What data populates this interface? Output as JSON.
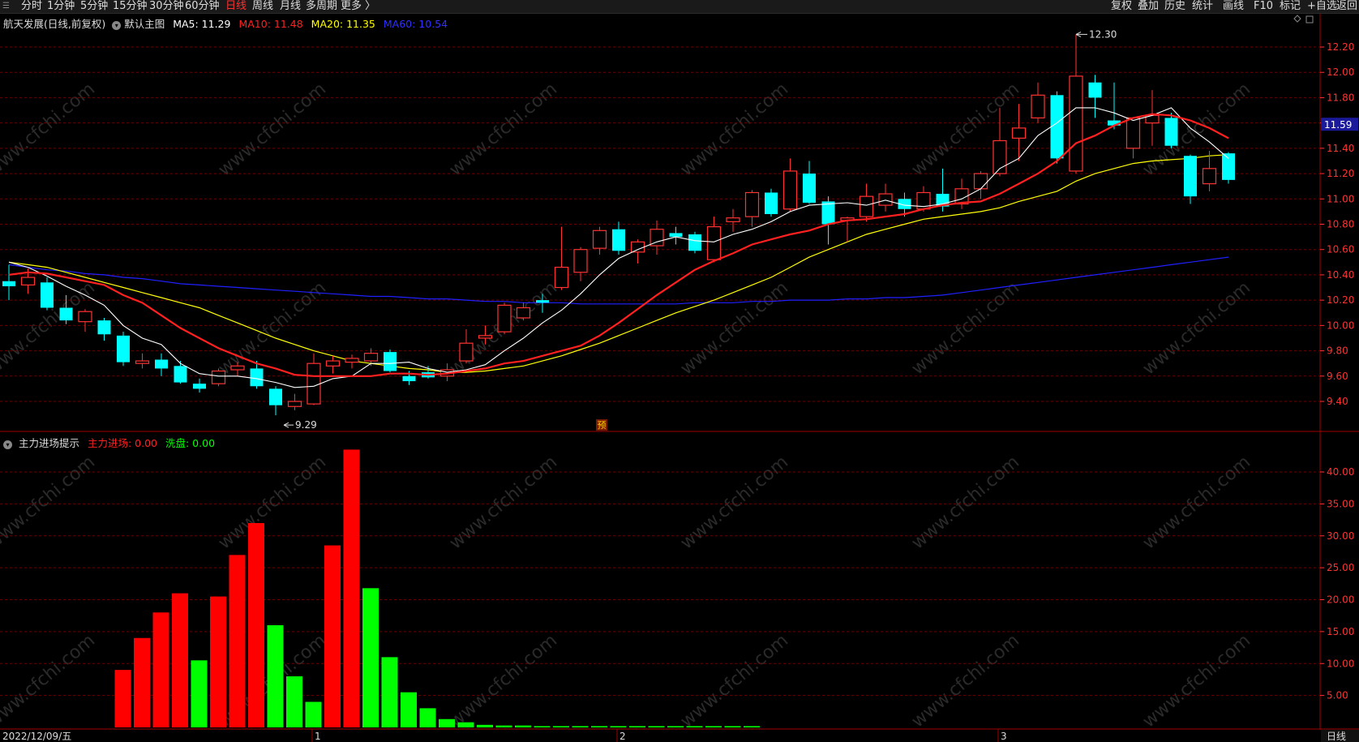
{
  "toolbar": {
    "left": [
      "分时",
      "1分钟",
      "5分钟",
      "15分钟",
      "30分钟",
      "60分钟",
      "日线",
      "周线",
      "月线",
      "多周期",
      "更多 〉"
    ],
    "active": "日线",
    "right": [
      "复权",
      "叠加",
      "历史",
      "统计",
      "画线",
      "F10",
      "标记",
      "+自选",
      "返回"
    ]
  },
  "main_header": {
    "stock": "航天发展(日线,前复权)",
    "template": "默认主图",
    "ma5": "MA5: 11.29",
    "ma10": "MA10: 11.48",
    "ma20": "MA20: 11.35",
    "ma60": "MA60: 10.54"
  },
  "sub_header": {
    "name": "主力进场提示",
    "s1": "主力进场: 0.00",
    "s2": "洗盘: 0.00"
  },
  "colors": {
    "up": "#ff3232",
    "down": "#00ffff",
    "ma5": "#ffffff",
    "ma10": "#ff2020",
    "ma20": "#ffff00",
    "ma60": "#2020ff",
    "grid": "#6a0000",
    "axis": "#ff3232",
    "bar_red": "#ff0000",
    "bar_green": "#00ff00"
  },
  "watermark": "www.cfchi.com",
  "price_marks": {
    "high": "12.30",
    "low": "9.29",
    "forecast": "预",
    "current": "11.59"
  },
  "bottom": {
    "date": "2022/12/09/五",
    "m1": "1",
    "m2": "2",
    "m3": "3",
    "period": "日线"
  },
  "chart_data": [
    {
      "type": "candlestick",
      "title": "航天发展(日线,前复权)",
      "ylim": [
        9.2,
        12.4
      ],
      "yticks": [
        9.4,
        9.6,
        9.8,
        10.0,
        10.2,
        10.4,
        10.6,
        10.8,
        11.0,
        11.2,
        11.4,
        11.6,
        11.8,
        12.0,
        12.2
      ],
      "current_price": 11.59,
      "candles": [
        {
          "o": 10.35,
          "h": 10.48,
          "l": 10.2,
          "c": 10.31
        },
        {
          "o": 10.32,
          "h": 10.45,
          "l": 10.25,
          "c": 10.38
        },
        {
          "o": 10.34,
          "h": 10.38,
          "l": 10.12,
          "c": 10.14
        },
        {
          "o": 10.14,
          "h": 10.24,
          "l": 10.01,
          "c": 10.04
        },
        {
          "o": 10.03,
          "h": 10.13,
          "l": 9.95,
          "c": 10.11
        },
        {
          "o": 10.04,
          "h": 10.06,
          "l": 9.88,
          "c": 9.93
        },
        {
          "o": 9.92,
          "h": 9.95,
          "l": 9.68,
          "c": 9.71
        },
        {
          "o": 9.7,
          "h": 9.78,
          "l": 9.66,
          "c": 9.72
        },
        {
          "o": 9.73,
          "h": 9.78,
          "l": 9.6,
          "c": 9.66
        },
        {
          "o": 9.68,
          "h": 9.72,
          "l": 9.54,
          "c": 9.55
        },
        {
          "o": 9.54,
          "h": 9.58,
          "l": 9.47,
          "c": 9.5
        },
        {
          "o": 9.54,
          "h": 9.66,
          "l": 9.52,
          "c": 9.64
        },
        {
          "o": 9.65,
          "h": 9.71,
          "l": 9.6,
          "c": 9.68
        },
        {
          "o": 9.66,
          "h": 9.72,
          "l": 9.5,
          "c": 9.52
        },
        {
          "o": 9.5,
          "h": 9.52,
          "l": 9.29,
          "c": 9.37
        },
        {
          "o": 9.36,
          "h": 9.46,
          "l": 9.33,
          "c": 9.4
        },
        {
          "o": 9.38,
          "h": 9.78,
          "l": 9.37,
          "c": 9.7
        },
        {
          "o": 9.68,
          "h": 9.76,
          "l": 9.62,
          "c": 9.72
        },
        {
          "o": 9.71,
          "h": 9.77,
          "l": 9.66,
          "c": 9.74
        },
        {
          "o": 9.72,
          "h": 9.82,
          "l": 9.68,
          "c": 9.78
        },
        {
          "o": 9.79,
          "h": 9.81,
          "l": 9.63,
          "c": 9.64
        },
        {
          "o": 9.6,
          "h": 9.64,
          "l": 9.53,
          "c": 9.56
        },
        {
          "o": 9.63,
          "h": 9.68,
          "l": 9.58,
          "c": 9.59
        },
        {
          "o": 9.6,
          "h": 9.7,
          "l": 9.56,
          "c": 9.65
        },
        {
          "o": 9.72,
          "h": 9.97,
          "l": 9.7,
          "c": 9.86
        },
        {
          "o": 9.9,
          "h": 10.0,
          "l": 9.85,
          "c": 9.92
        },
        {
          "o": 9.95,
          "h": 10.18,
          "l": 9.93,
          "c": 10.16
        },
        {
          "o": 10.06,
          "h": 10.18,
          "l": 10.04,
          "c": 10.14
        },
        {
          "o": 10.2,
          "h": 10.25,
          "l": 10.1,
          "c": 10.18
        },
        {
          "o": 10.3,
          "h": 10.78,
          "l": 10.28,
          "c": 10.46
        },
        {
          "o": 10.42,
          "h": 10.62,
          "l": 10.35,
          "c": 10.6
        },
        {
          "o": 10.61,
          "h": 10.78,
          "l": 10.56,
          "c": 10.75
        },
        {
          "o": 10.76,
          "h": 10.82,
          "l": 10.56,
          "c": 10.59
        },
        {
          "o": 10.58,
          "h": 10.68,
          "l": 10.49,
          "c": 10.66
        },
        {
          "o": 10.63,
          "h": 10.83,
          "l": 10.56,
          "c": 10.76
        },
        {
          "o": 10.73,
          "h": 10.78,
          "l": 10.64,
          "c": 10.7
        },
        {
          "o": 10.72,
          "h": 10.74,
          "l": 10.57,
          "c": 10.59
        },
        {
          "o": 10.52,
          "h": 10.86,
          "l": 10.5,
          "c": 10.78
        },
        {
          "o": 10.82,
          "h": 10.92,
          "l": 10.74,
          "c": 10.85
        },
        {
          "o": 10.86,
          "h": 11.07,
          "l": 10.78,
          "c": 11.05
        },
        {
          "o": 11.05,
          "h": 11.08,
          "l": 10.86,
          "c": 10.88
        },
        {
          "o": 10.92,
          "h": 11.32,
          "l": 10.9,
          "c": 11.22
        },
        {
          "o": 11.2,
          "h": 11.3,
          "l": 10.96,
          "c": 10.97
        },
        {
          "o": 10.98,
          "h": 11.02,
          "l": 10.64,
          "c": 10.8
        },
        {
          "o": 10.83,
          "h": 10.86,
          "l": 10.66,
          "c": 10.85
        },
        {
          "o": 10.86,
          "h": 11.12,
          "l": 10.82,
          "c": 11.02
        },
        {
          "o": 10.95,
          "h": 11.12,
          "l": 10.9,
          "c": 11.04
        },
        {
          "o": 11.0,
          "h": 11.05,
          "l": 10.86,
          "c": 10.92
        },
        {
          "o": 10.92,
          "h": 11.1,
          "l": 10.9,
          "c": 11.05
        },
        {
          "o": 11.04,
          "h": 11.24,
          "l": 10.9,
          "c": 10.94
        },
        {
          "o": 10.96,
          "h": 11.16,
          "l": 10.92,
          "c": 11.08
        },
        {
          "o": 11.08,
          "h": 11.22,
          "l": 11.0,
          "c": 11.2
        },
        {
          "o": 11.2,
          "h": 11.72,
          "l": 11.18,
          "c": 11.46
        },
        {
          "o": 11.48,
          "h": 11.75,
          "l": 11.3,
          "c": 11.56
        },
        {
          "o": 11.64,
          "h": 11.92,
          "l": 11.6,
          "c": 11.82
        },
        {
          "o": 11.82,
          "h": 11.85,
          "l": 11.28,
          "c": 11.32
        },
        {
          "o": 11.22,
          "h": 12.3,
          "l": 11.2,
          "c": 11.97
        },
        {
          "o": 11.92,
          "h": 11.98,
          "l": 11.64,
          "c": 11.8
        },
        {
          "o": 11.62,
          "h": 11.92,
          "l": 11.55,
          "c": 11.58
        },
        {
          "o": 11.4,
          "h": 11.62,
          "l": 11.32,
          "c": 11.64
        },
        {
          "o": 11.6,
          "h": 11.86,
          "l": 11.42,
          "c": 11.66
        },
        {
          "o": 11.64,
          "h": 11.68,
          "l": 11.4,
          "c": 11.42
        },
        {
          "o": 11.34,
          "h": 11.35,
          "l": 10.96,
          "c": 11.02
        },
        {
          "o": 11.12,
          "h": 11.38,
          "l": 11.06,
          "c": 11.24
        },
        {
          "o": 11.36,
          "h": 11.37,
          "l": 11.12,
          "c": 11.15
        }
      ],
      "ma5": [
        10.5,
        10.46,
        10.39,
        10.31,
        10.24,
        10.16,
        10.0,
        9.9,
        9.85,
        9.7,
        9.62,
        9.6,
        9.6,
        9.58,
        9.55,
        9.51,
        9.52,
        9.58,
        9.6,
        9.7,
        9.7,
        9.71,
        9.66,
        9.63,
        9.65,
        9.69,
        9.8,
        9.9,
        10.02,
        10.12,
        10.25,
        10.4,
        10.53,
        10.6,
        10.66,
        10.7,
        10.67,
        10.66,
        10.72,
        10.76,
        10.82,
        10.9,
        10.95,
        10.96,
        10.97,
        10.95,
        10.99,
        10.95,
        10.94,
        10.96,
        11.0,
        11.08,
        11.24,
        11.32,
        11.5,
        11.6,
        11.72,
        11.72,
        11.68,
        11.62,
        11.66,
        11.72,
        11.56,
        11.45,
        11.32
      ],
      "ma10": [
        10.4,
        10.42,
        10.41,
        10.38,
        10.35,
        10.32,
        10.24,
        10.18,
        10.08,
        9.98,
        9.9,
        9.82,
        9.76,
        9.7,
        9.66,
        9.61,
        9.6,
        9.6,
        9.6,
        9.6,
        9.62,
        9.62,
        9.61,
        9.62,
        9.64,
        9.66,
        9.7,
        9.72,
        9.76,
        9.8,
        9.84,
        9.92,
        10.02,
        10.13,
        10.24,
        10.34,
        10.44,
        10.51,
        10.57,
        10.64,
        10.68,
        10.72,
        10.75,
        10.8,
        10.83,
        10.84,
        10.86,
        10.88,
        10.92,
        10.95,
        10.97,
        10.98,
        11.04,
        11.12,
        11.2,
        11.3,
        11.44,
        11.5,
        11.58,
        11.64,
        11.67,
        11.66,
        11.62,
        11.56,
        11.48
      ],
      "ma20": [
        10.5,
        10.48,
        10.46,
        10.42,
        10.38,
        10.34,
        10.3,
        10.26,
        10.22,
        10.18,
        10.14,
        10.08,
        10.02,
        9.96,
        9.9,
        9.85,
        9.8,
        9.76,
        9.72,
        9.7,
        9.68,
        9.66,
        9.65,
        9.63,
        9.63,
        9.64,
        9.66,
        9.68,
        9.72,
        9.76,
        9.81,
        9.86,
        9.92,
        9.98,
        10.04,
        10.1,
        10.15,
        10.2,
        10.26,
        10.32,
        10.38,
        10.46,
        10.54,
        10.6,
        10.66,
        10.72,
        10.76,
        10.8,
        10.84,
        10.86,
        10.88,
        10.9,
        10.93,
        10.98,
        11.02,
        11.06,
        11.14,
        11.2,
        11.24,
        11.28,
        11.3,
        11.31,
        11.32,
        11.34,
        11.35
      ],
      "ma60": [
        10.48,
        10.46,
        10.44,
        10.43,
        10.41,
        10.4,
        10.38,
        10.37,
        10.35,
        10.33,
        10.32,
        10.31,
        10.3,
        10.29,
        10.28,
        10.27,
        10.26,
        10.25,
        10.24,
        10.23,
        10.23,
        10.22,
        10.21,
        10.21,
        10.2,
        10.19,
        10.19,
        10.18,
        10.18,
        10.18,
        10.17,
        10.17,
        10.17,
        10.17,
        10.17,
        10.17,
        10.18,
        10.18,
        10.18,
        10.19,
        10.19,
        10.2,
        10.2,
        10.2,
        10.21,
        10.21,
        10.22,
        10.22,
        10.23,
        10.24,
        10.26,
        10.28,
        10.3,
        10.32,
        10.34,
        10.36,
        10.38,
        10.4,
        10.42,
        10.44,
        10.46,
        10.48,
        10.5,
        10.52,
        10.54
      ]
    },
    {
      "type": "bar",
      "title": "主力进场提示",
      "ylim": [
        0,
        45
      ],
      "yticks": [
        5,
        10,
        15,
        20,
        25,
        30,
        35,
        40
      ],
      "series": [
        {
          "name": "主力进场",
          "values": [
            0,
            0,
            0,
            9,
            14,
            18,
            21,
            0,
            20.5,
            27,
            32,
            0,
            0,
            0,
            28.5,
            43.5,
            0,
            0,
            0,
            0,
            0,
            0,
            0,
            0,
            0,
            0,
            0,
            0,
            0,
            0,
            0,
            0,
            0,
            0,
            0,
            0,
            0
          ]
        },
        {
          "name": "洗盘",
          "values": [
            0,
            0,
            0,
            0,
            0,
            0,
            0,
            10.5,
            0,
            0,
            0,
            16,
            8,
            4,
            0,
            0,
            21.8,
            11,
            5.5,
            3,
            1.3,
            0.8,
            0.4,
            0.3,
            0.3,
            0.2,
            0.2,
            0.2,
            0.2,
            0.2,
            0.2,
            0.2,
            0.2,
            0.2,
            0.2,
            0.2,
            0.2
          ]
        }
      ]
    }
  ]
}
